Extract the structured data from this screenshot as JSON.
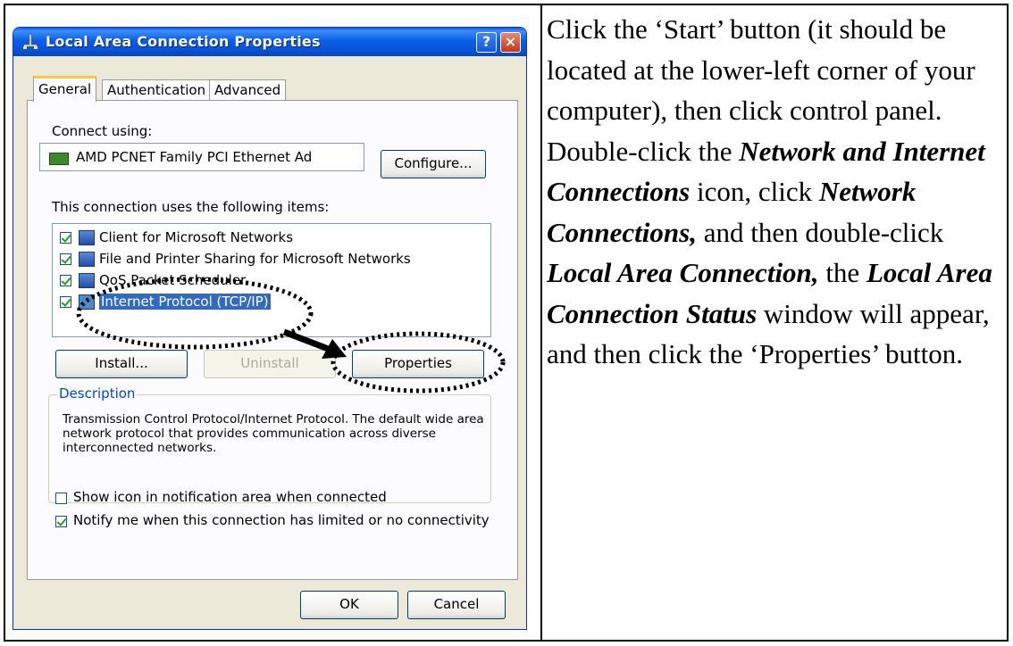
{
  "dialog": {
    "title": "Local Area Connection Properties",
    "help_button": "?",
    "close_button": "×",
    "tabs": [
      {
        "label": "General",
        "active": true
      },
      {
        "label": "Authentication",
        "active": false
      },
      {
        "label": "Advanced",
        "active": false
      }
    ],
    "connect_using_label": "Connect using:",
    "adapter_name": "AMD PCNET Family PCI Ethernet Ad",
    "configure_button": "Configure...",
    "items_label": "This connection uses the following items:",
    "items": [
      {
        "label": "Client for Microsoft Networks",
        "checked": true,
        "selected": false
      },
      {
        "label": "File and Printer Sharing for Microsoft Networks",
        "checked": true,
        "selected": false
      },
      {
        "label": "QoS Packet Scheduler",
        "checked": true,
        "selected": false
      },
      {
        "label": "Internet Protocol (TCP/IP)",
        "checked": true,
        "selected": true
      }
    ],
    "install_button": "Install...",
    "uninstall_button": "Uninstall",
    "properties_button": "Properties",
    "description_legend": "Description",
    "description_text": "Transmission Control Protocol/Internet Protocol. The default wide area network protocol that provides communication across diverse interconnected networks.",
    "show_icon_label": "Show icon in notification area when connected",
    "show_icon_checked": false,
    "notify_label": "Notify me when this connection has limited or no connectivity",
    "notify_checked": true,
    "ok_button": "OK",
    "cancel_button": "Cancel"
  },
  "instructions": {
    "p1": "Click the ‘Start’ button (it should be located at the lower-left corner of your computer), then click control panel. Double-click the ",
    "b1": "Network and Internet Connections",
    "p2": " icon, click ",
    "b2": "Network Connections,",
    "p3": " and then double-click ",
    "b3": "Local Area Connection,",
    "p4": " the ",
    "b4": "Local Area Connection Status",
    "p5": " window will appear, and then click the ‘Properties’ button."
  },
  "colors": {
    "titlebar": "#0b5ee6",
    "dialog_bg": "#ece9d8",
    "selection": "#316ac5",
    "tab_highlight": "#ffc83c",
    "description_legend": "#0046d5"
  }
}
